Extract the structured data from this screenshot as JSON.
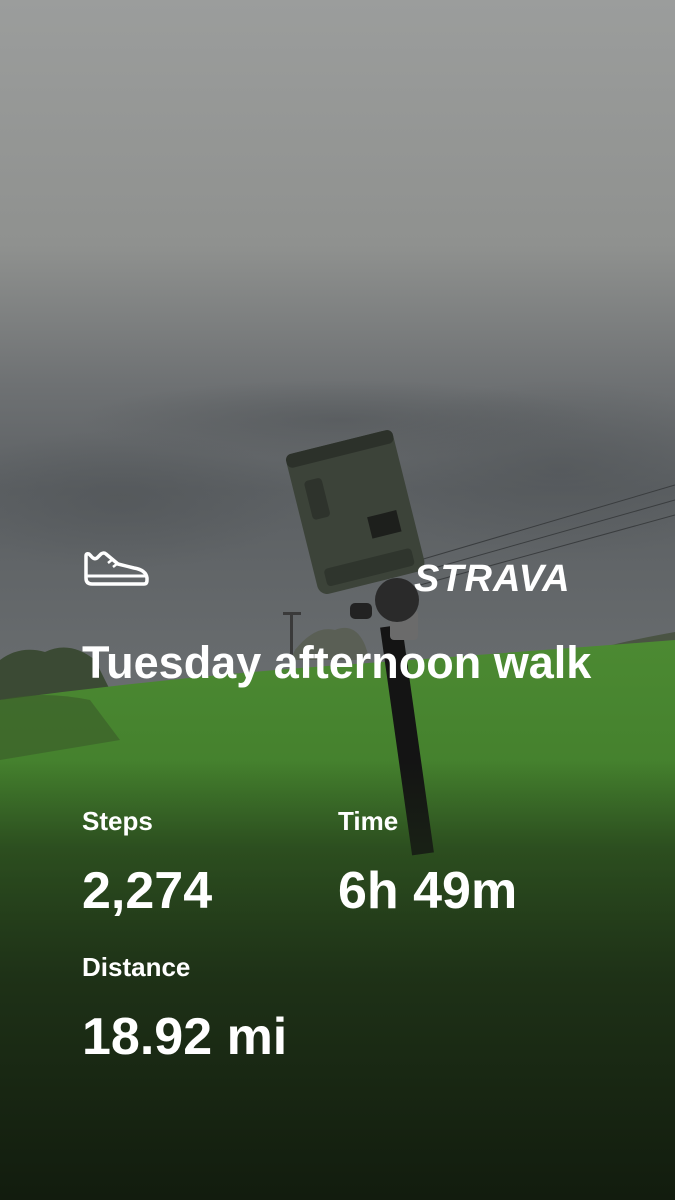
{
  "activity": {
    "icon": "shoe-icon",
    "brand": "STRAVA",
    "title": "Tuesday afternoon walk"
  },
  "stats": {
    "steps": {
      "label": "Steps",
      "value": "2,274"
    },
    "time": {
      "label": "Time",
      "value": "6h 49m"
    },
    "distance": {
      "label": "Distance",
      "value": "18.92 mi"
    }
  },
  "colors": {
    "text": "#ffffff",
    "sky": "#8a8c8b",
    "grass": "#3f7a2a"
  }
}
